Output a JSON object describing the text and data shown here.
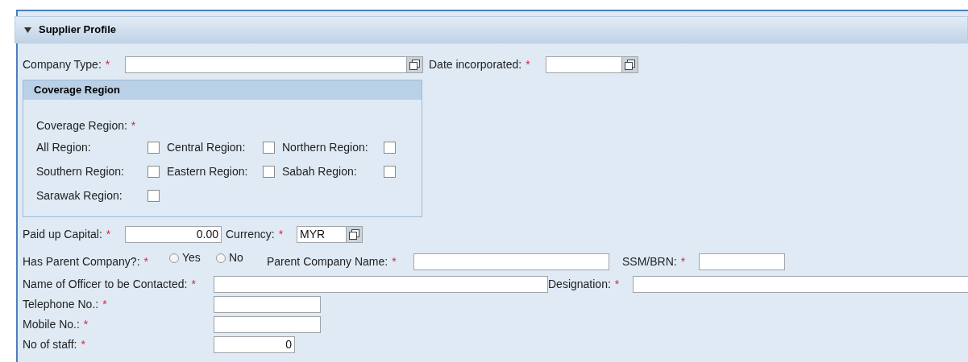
{
  "section": {
    "title": "Supplier Profile",
    "expanded": true
  },
  "required_mark": "*",
  "company_type": {
    "label": "Company Type:",
    "required": true
  },
  "date_incorporated": {
    "label": "Date incorporated:",
    "required": true
  },
  "coverage": {
    "title": "Coverage Region",
    "label": "Coverage Region:",
    "required": true,
    "regions": [
      {
        "label": "All Region:",
        "checked": false
      },
      {
        "label": "Central Region:",
        "checked": false
      },
      {
        "label": "Northern Region:",
        "checked": false
      },
      {
        "label": "Southern Region:",
        "checked": false
      },
      {
        "label": "Eastern Region:",
        "checked": false
      },
      {
        "label": "Sabah Region:",
        "checked": false
      },
      {
        "label": "Sarawak Region:",
        "checked": false
      }
    ]
  },
  "paid_up_capital": {
    "label": "Paid up Capital:",
    "required": true,
    "value": "0.00"
  },
  "currency": {
    "label": "Currency:",
    "required": true,
    "value": "MYR"
  },
  "has_parent": {
    "label": "Has Parent Company?:",
    "required": true,
    "options": [
      {
        "label": "Yes",
        "selected": false
      },
      {
        "label": "No",
        "selected": false
      }
    ]
  },
  "parent_company_name": {
    "label": "Parent Company Name:",
    "required": true
  },
  "ssm_brn": {
    "label": "SSM/BRN:",
    "required": true
  },
  "officer_name": {
    "label": "Name of Officer to be Contacted:",
    "required": true
  },
  "designation": {
    "label": "Designation:",
    "required": true
  },
  "telephone": {
    "label": "Telephone No.:",
    "required": true
  },
  "mobile": {
    "label": "Mobile No.:",
    "required": true
  },
  "staff": {
    "label": "No of staff:",
    "required": true,
    "value": "0"
  }
}
